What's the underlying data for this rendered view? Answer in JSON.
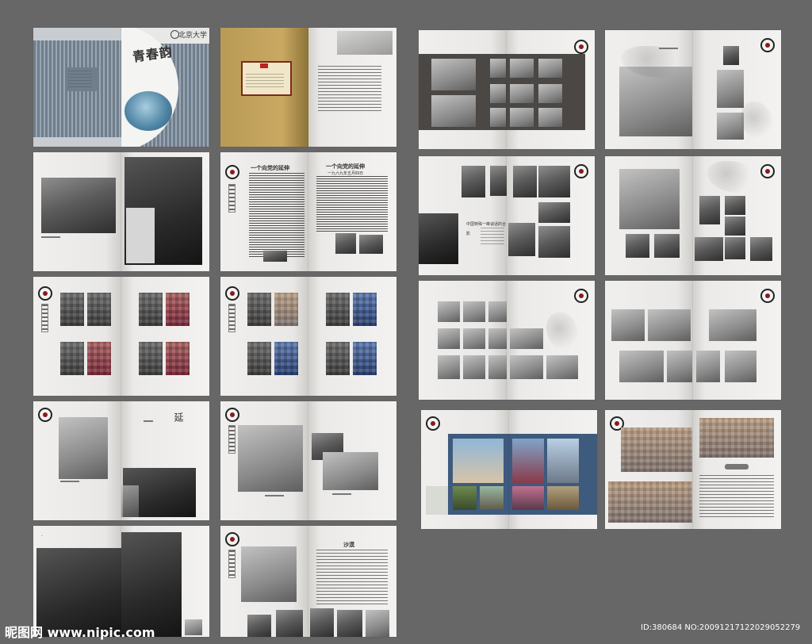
{
  "title": "青春韵",
  "cover_logo": "北京大学",
  "spread2_heading": "一个向党的延伸",
  "spread3_heading": "一个向党的延伸",
  "spread3_subheading": "一九六九年五月四日",
  "spread12_caption": "中国特殊一峰谈话的合影",
  "section_label": "沙漠",
  "watermark_left": "昵图网 www.nipic.com",
  "watermark_right": "ID:380684 NO:20091217122029052279",
  "colors": {
    "background": "#676767",
    "cover_stripe": "#6f7e8c",
    "gold": "#b99a55",
    "navy_band": "#3e5a7d",
    "dark_band": "#4a4744"
  }
}
